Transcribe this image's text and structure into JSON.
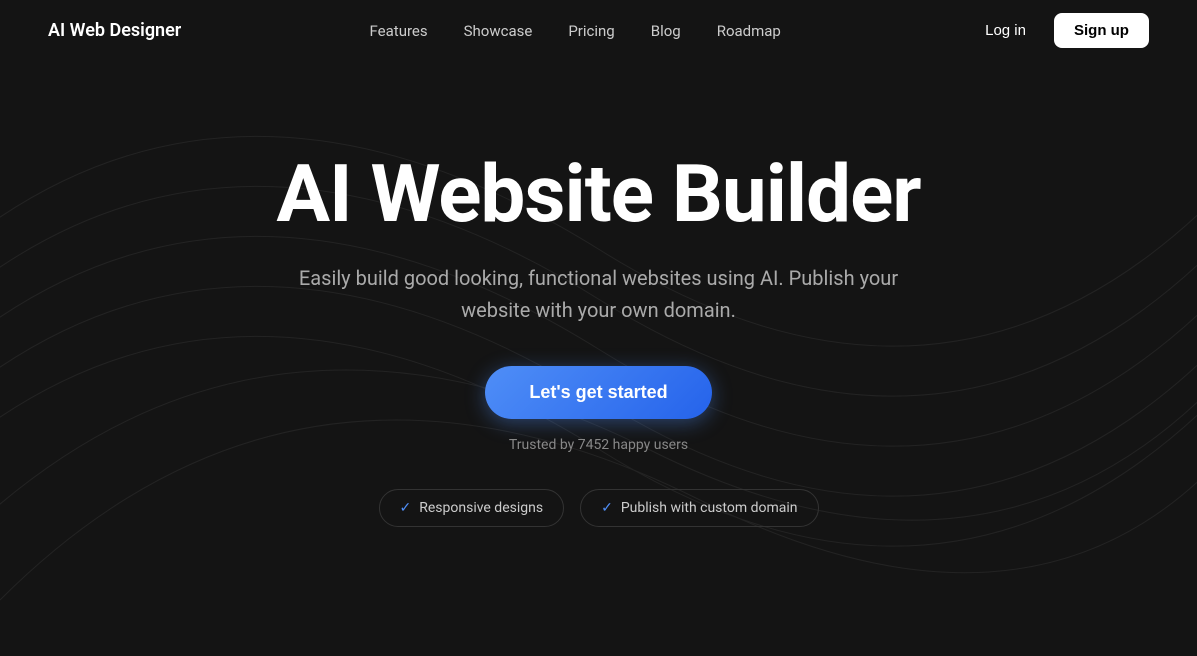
{
  "nav": {
    "logo": "AI Web Designer",
    "links": [
      {
        "label": "Features",
        "id": "features"
      },
      {
        "label": "Showcase",
        "id": "showcase"
      },
      {
        "label": "Pricing",
        "id": "pricing"
      },
      {
        "label": "Blog",
        "id": "blog"
      },
      {
        "label": "Roadmap",
        "id": "roadmap"
      }
    ],
    "login_label": "Log in",
    "signup_label": "Sign up"
  },
  "hero": {
    "title": "AI Website Builder",
    "subtitle": "Easily build good looking, functional websites using AI. Publish your website with your own domain.",
    "cta_label": "Let's get started",
    "trusted_text": "Trusted by 7452 happy users",
    "badges": [
      {
        "label": "Responsive designs",
        "check": "✓"
      },
      {
        "label": "Publish with custom domain",
        "check": "✓"
      }
    ]
  }
}
